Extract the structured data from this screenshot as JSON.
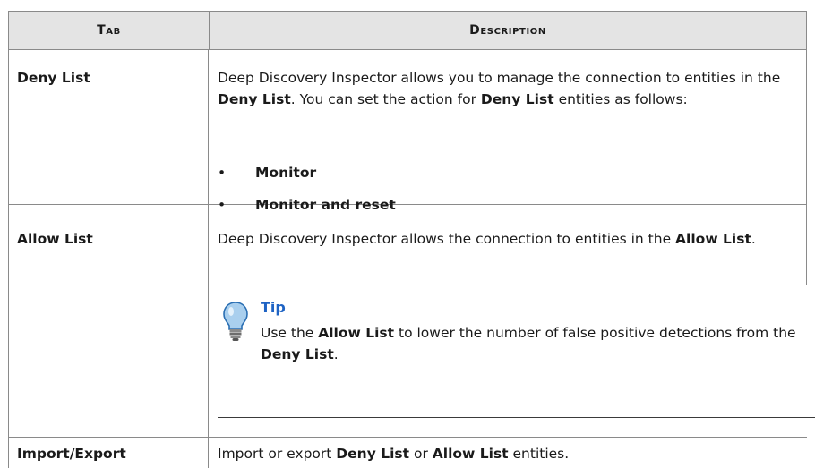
{
  "table": {
    "headers": {
      "tab": "Tab",
      "description": "Description"
    },
    "rows": [
      {
        "tab": "Deny List",
        "desc": {
          "t1": "Deep Discovery Inspector allows you to manage the connection to entities in the ",
          "b1": "Deny List",
          "t2": ". You can set the action for ",
          "b2": "Deny List",
          "t3": " entities as follows:"
        },
        "bullets": [
          "Monitor",
          "Monitor and reset"
        ]
      },
      {
        "tab": "Allow List",
        "desc": {
          "t1": "Deep Discovery Inspector allows the connection to entities in the ",
          "b1": "Allow List",
          "t2": "."
        },
        "tip": {
          "title": "Tip",
          "t1": "Use the ",
          "b1": "Allow List",
          "t2": " to lower the number of false positive detections from the ",
          "b2": "Deny List",
          "t3": "."
        }
      },
      {
        "tab": "Import/Export",
        "desc": {
          "t1": "Import or export ",
          "b1": "Deny List",
          "t2": " or ",
          "b2": "Allow List",
          "t3": " entities."
        }
      }
    ]
  },
  "colors": {
    "tip_title": "#1e63c4",
    "header_bg": "#e4e4e4",
    "bulb": "#a9cfee"
  },
  "icons": {
    "tip": "lightbulb-icon"
  }
}
